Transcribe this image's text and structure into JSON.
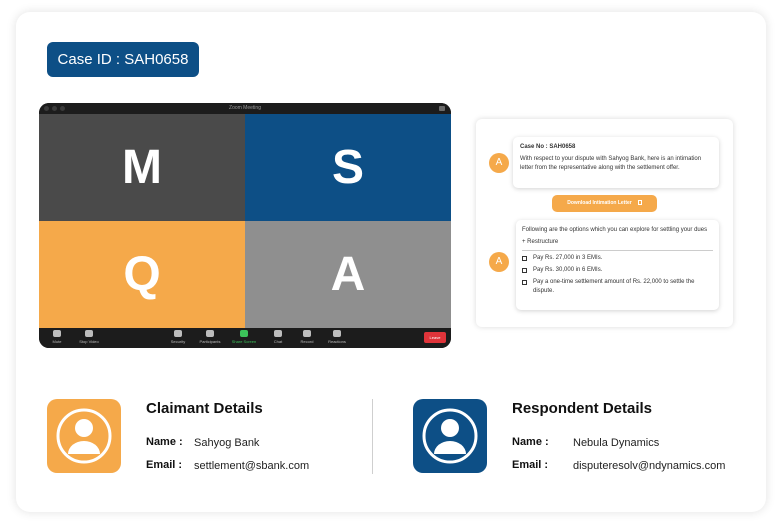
{
  "case_badge": "Case ID : SAH0658",
  "zoom": {
    "title": "Zoom Meeting",
    "tiles": [
      "M",
      "S",
      "Q",
      "A"
    ],
    "toolbar": {
      "mute": "Mute",
      "stop_video": "Stop Video",
      "security": "Security",
      "participants": "Participants",
      "share_screen": "Share Screen",
      "chat": "Chat",
      "record": "Record",
      "reactions": "Reactions",
      "leave": "Leave"
    }
  },
  "chat": {
    "avatar": "A",
    "message1_title": "Case No : SAH0658",
    "message1_body": "With respect to your dispute with Sahyog Bank, here is an intimation letter from the representative along with the settlement offer.",
    "download_label": "Download Intimation Letter",
    "message2_intro": "Following are the options which you can explore for settling your dues",
    "restructure": "+    Restructure",
    "options": [
      "Pay Rs. 27,000 in 3 EMIs.",
      "Pay Rs. 30,000 in 6 EMIs.",
      "Pay a one-time settlement amount of Rs. 22,000 to settle the dispute."
    ]
  },
  "claimant": {
    "title": "Claimant Details",
    "name_label": "Name :",
    "name": "Sahyog Bank",
    "email_label": "Email :",
    "email": "settlement@sbank.com"
  },
  "respondent": {
    "title": "Respondent Details",
    "name_label": "Name :",
    "name": "Nebula Dynamics",
    "email_label": "Email :",
    "email": "disputeresolv@ndynamics.com"
  },
  "colors": {
    "primary_blue": "#0d4f86",
    "accent_orange": "#f5a94a",
    "tile_dark": "#4a4a4a",
    "tile_gray": "#8f8f8f",
    "leave_red": "#e0343a"
  }
}
